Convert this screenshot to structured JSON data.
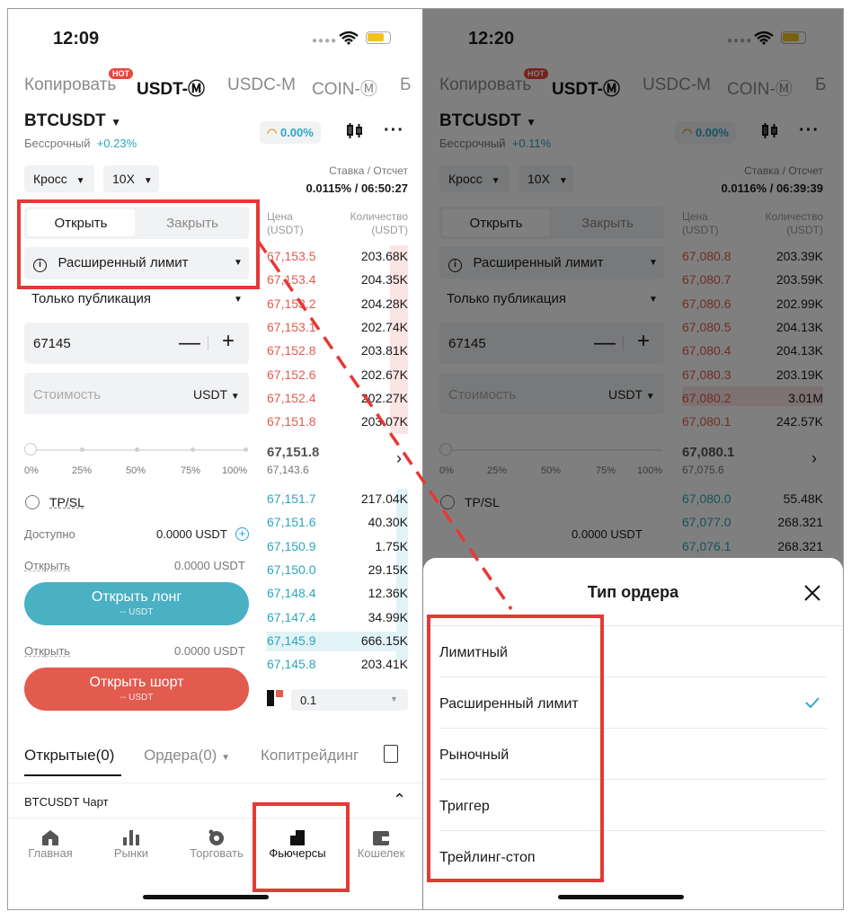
{
  "left": {
    "status": {
      "time": "12:09"
    },
    "top_tabs": [
      "Копировать",
      "USDT-Ⓜ",
      "USDC-M",
      "COIN-Ⓜ",
      "Б"
    ],
    "hot_label": "HOT",
    "symbol": "BTCUSDT",
    "contract_type": "Бессрочный",
    "change": "+0.23%",
    "pct_badge": "0.00%",
    "margin_mode": "Кросс",
    "leverage": "10X",
    "funding_label": "Ставка / Отсчет",
    "funding_value": "0.0115% / 06:50:27",
    "open_tab": "Открыть",
    "close_tab": "Закрыть",
    "order_type": "Расширенный лимит",
    "post_only": "Только публикация",
    "price_value": "67145",
    "cost_placeholder": "Стоимость",
    "cost_unit": "USDT",
    "slider_labels": [
      "0%",
      "25%",
      "50%",
      "75%",
      "100%"
    ],
    "tpsl": "TP/SL",
    "available_label": "Доступно",
    "available_value": "0.0000 USDT",
    "open_label_1": "Открыть",
    "open_value_1": "0.0000 USDT",
    "long_btn": "Открыть лонг",
    "long_sub": "-- USDT",
    "open_label_2": "Открыть",
    "open_value_2": "0.0000 USDT",
    "short_btn": "Открыть шорт",
    "short_sub": "-- USDT",
    "orderbook": {
      "price_head": [
        "Цена",
        "(USDT)"
      ],
      "qty_head": [
        "Количество",
        "(USDT)"
      ],
      "asks": [
        {
          "price": "67,153.5",
          "qty": "203.68K"
        },
        {
          "price": "67,153.4",
          "qty": "204.35K"
        },
        {
          "price": "67,153.2",
          "qty": "204.28K"
        },
        {
          "price": "67,153.1",
          "qty": "202.74K"
        },
        {
          "price": "67,152.8",
          "qty": "203.81K"
        },
        {
          "price": "67,152.6",
          "qty": "202.67K"
        },
        {
          "price": "67,152.4",
          "qty": "202.27K"
        },
        {
          "price": "67,151.8",
          "qty": "203.07K"
        }
      ],
      "mid_price": "67,151.8",
      "mark_price": "67,143.6",
      "bids": [
        {
          "price": "67,151.7",
          "qty": "217.04K"
        },
        {
          "price": "67,151.6",
          "qty": "40.30K"
        },
        {
          "price": "67,150.9",
          "qty": "1.75K"
        },
        {
          "price": "67,150.0",
          "qty": "29.15K"
        },
        {
          "price": "67,148.4",
          "qty": "12.36K"
        },
        {
          "price": "67,147.4",
          "qty": "34.99K"
        },
        {
          "price": "67,145.9",
          "qty": "666.15K"
        },
        {
          "price": "67,145.8",
          "qty": "203.41K"
        }
      ],
      "precision": "0.1"
    },
    "bottom_tabs": [
      "Открытые(0)",
      "Ордера(0)",
      "Копитрейдинг"
    ],
    "chart_row": "BTCUSDT  Чарт",
    "nav": [
      "Главная",
      "Рынки",
      "Торговать",
      "Фьючерсы",
      "Кошелек"
    ]
  },
  "right": {
    "status": {
      "time": "12:20"
    },
    "top_tabs": [
      "Копировать",
      "USDT-Ⓜ",
      "USDC-M",
      "COIN-Ⓜ",
      "Б"
    ],
    "hot_label": "HOT",
    "symbol": "BTCUSDT",
    "contract_type": "Бессрочный",
    "change": "+0.11%",
    "pct_badge": "0.00%",
    "margin_mode": "Кросс",
    "leverage": "10X",
    "funding_label": "Ставка / Отсчет",
    "funding_value": "0.0116% / 06:39:39",
    "open_tab": "Открыть",
    "close_tab": "Закрыть",
    "order_type": "Расширенный лимит",
    "post_only": "Только публикация",
    "price_value": "67145",
    "cost_placeholder": "Стоимость",
    "cost_unit": "USDT",
    "slider_labels": [
      "0%",
      "25%",
      "50%",
      "75%",
      "100%"
    ],
    "tpsl": "TP/SL",
    "available_value": "0.0000 USDT",
    "orderbook": {
      "price_head": [
        "Цена",
        "(USDT)"
      ],
      "qty_head": [
        "Количество",
        "(USDT)"
      ],
      "asks": [
        {
          "price": "67,080.8",
          "qty": "203.39K"
        },
        {
          "price": "67,080.7",
          "qty": "203.59K"
        },
        {
          "price": "67,080.6",
          "qty": "202.99K"
        },
        {
          "price": "67,080.5",
          "qty": "204.13K"
        },
        {
          "price": "67,080.4",
          "qty": "204.13K"
        },
        {
          "price": "67,080.3",
          "qty": "203.19K"
        },
        {
          "price": "67,080.2",
          "qty": "3.01M"
        },
        {
          "price": "67,080.1",
          "qty": "242.57K"
        }
      ],
      "mid_price": "67,080.1",
      "mark_price": "67,075.6",
      "bids": [
        {
          "price": "67,080.0",
          "qty": "55.48K"
        },
        {
          "price": "67,077.0",
          "qty": "268.321"
        },
        {
          "price": "67,076.1",
          "qty": "268.321"
        }
      ]
    },
    "sheet": {
      "title": "Тип ордера",
      "items": [
        "Лимитный",
        "Расширенный лимит",
        "Рыночный",
        "Триггер",
        "Трейлинг-стоп"
      ]
    }
  }
}
